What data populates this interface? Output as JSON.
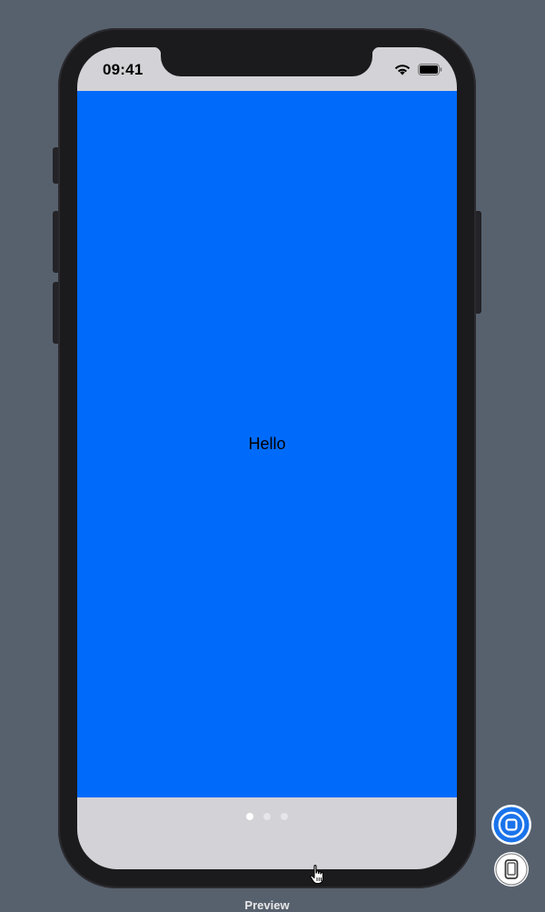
{
  "status_bar": {
    "time": "09:41"
  },
  "icons": {
    "wifi": "wifi-icon",
    "battery": "battery-icon",
    "live": "live-preview-icon",
    "device": "device-settings-icon",
    "cursor": "hand-cursor-icon"
  },
  "content": {
    "text": "Hello",
    "background_color": "#006bfa"
  },
  "page_control": {
    "count": 3,
    "current": 1
  },
  "preview": {
    "label": "Preview"
  },
  "colors": {
    "canvas": "#57616d",
    "phone_frame": "#1b1a1d",
    "screen_chrome": "#d3d2d6",
    "accent": "#1a73ea"
  }
}
